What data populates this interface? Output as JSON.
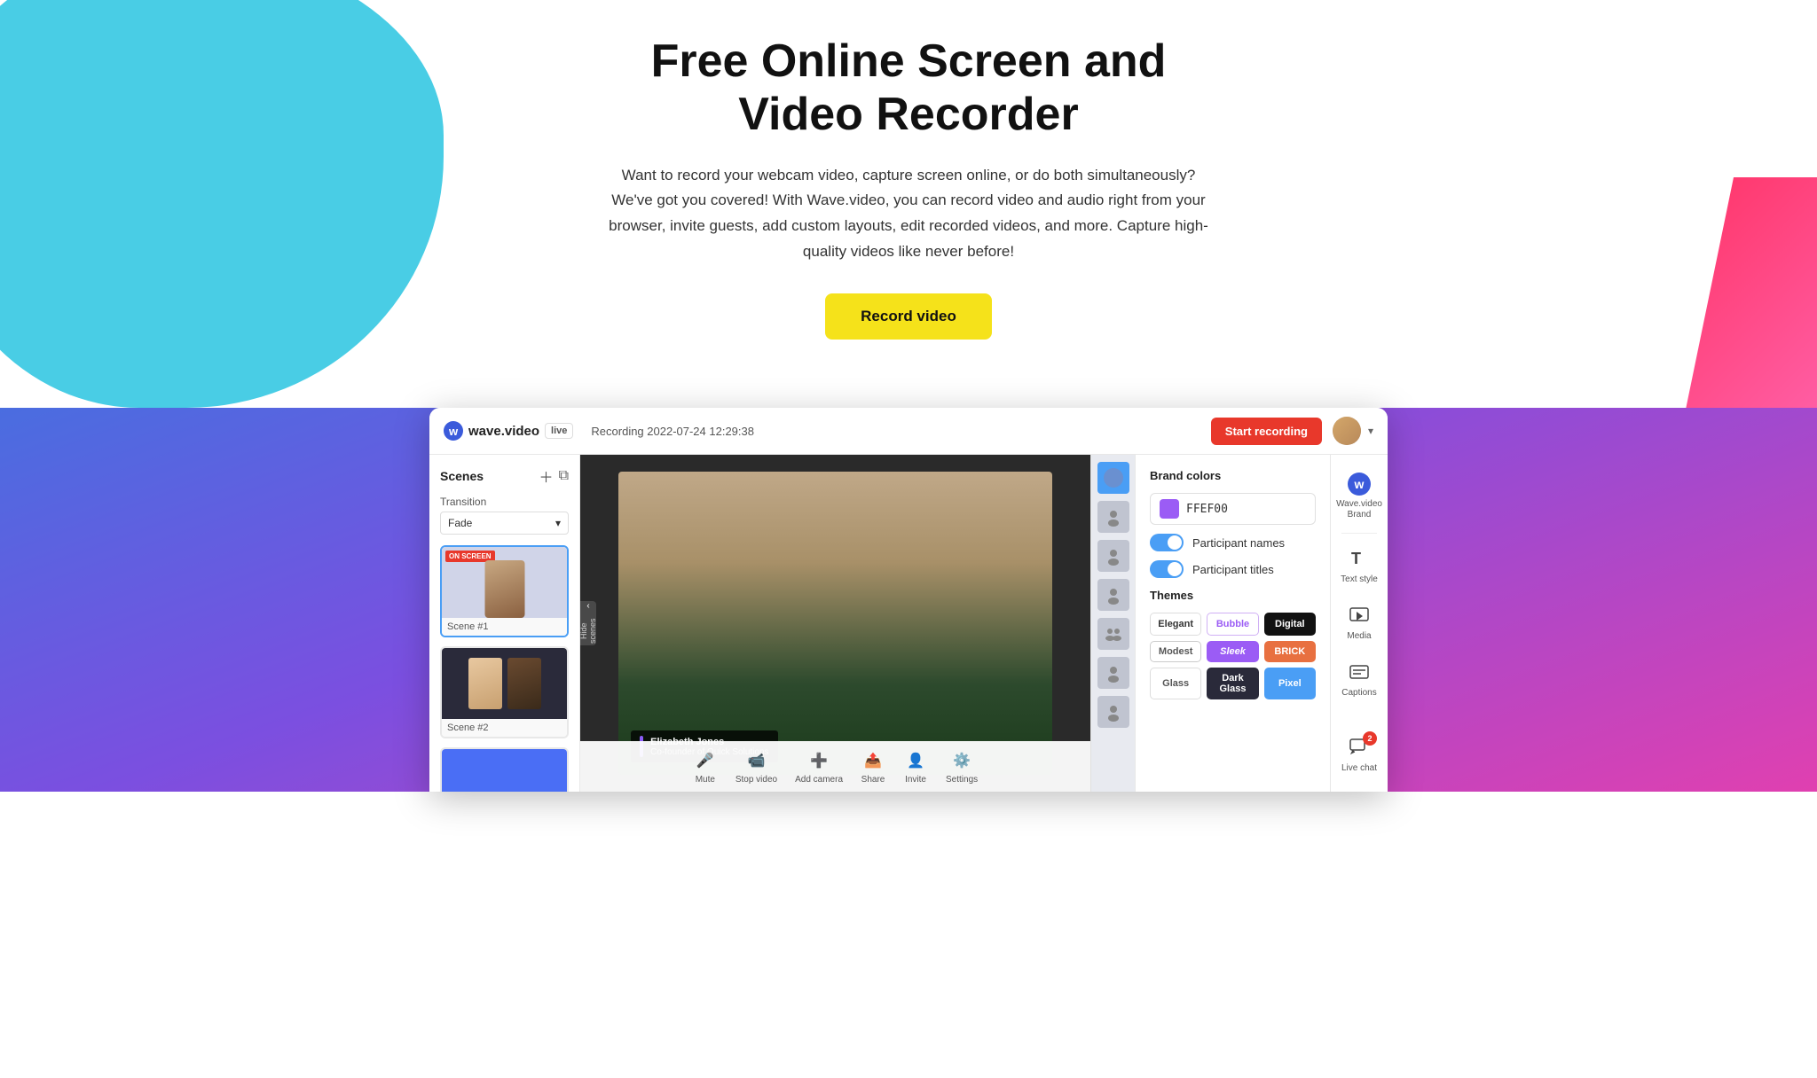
{
  "hero": {
    "title_line1": "Free Online Screen and",
    "title_line2": "Video Recorder",
    "description": "Want to record your webcam video, capture screen online, or do both simultaneously? We've got you covered! With Wave.video, you can record video and audio right from your browser, invite guests, add custom layouts, edit recorded videos, and more. Capture high-quality videos like never before!",
    "cta_label": "Record video"
  },
  "app": {
    "logo_text": "w",
    "app_name": "wave.video",
    "live_badge": "live",
    "recording_info": "Recording 2022-07-24 12:29:38",
    "start_recording_label": "Start recording",
    "scenes_title": "Scenes",
    "transition_label": "Transition",
    "transition_value": "Fade",
    "hide_scenes_label": "Hide scenes",
    "scene1_badge": "ON SCREEN",
    "scene1_label": "Scene #1",
    "scene2_label": "Scene #2",
    "name_overlay_name": "Elizabeth Jones",
    "name_overlay_title": "Co-founder of Quick Solutions",
    "controls": {
      "mute_label": "Mute",
      "stop_video_label": "Stop video",
      "add_camera_label": "Add camera",
      "share_label": "Share",
      "invite_label": "Invite",
      "settings_label": "Settings"
    },
    "brand_panel": {
      "section_title": "Brand colors",
      "color_value": "FFEF00",
      "participant_names_label": "Participant names",
      "participant_titles_label": "Participant titles",
      "themes_title": "Themes",
      "themes": [
        {
          "label": "Elegant",
          "style": "elegant"
        },
        {
          "label": "Bubble",
          "style": "bubble"
        },
        {
          "label": "Digital",
          "style": "digital"
        },
        {
          "label": "Modest",
          "style": "modest"
        },
        {
          "label": "Sleek",
          "style": "sleek"
        },
        {
          "label": "BRICK",
          "style": "brick"
        },
        {
          "label": "Glass",
          "style": "glass"
        },
        {
          "label": "Dark Glass",
          "style": "dark-glass"
        },
        {
          "label": "Pixel",
          "style": "pixel"
        }
      ]
    },
    "tools": {
      "brand_name": "Wave.video",
      "brand_sub": "Brand",
      "text_style_label": "Text style",
      "media_label": "Media",
      "captions_label": "Captions",
      "live_chat_label": "Live chat",
      "notification_count": "2"
    }
  }
}
